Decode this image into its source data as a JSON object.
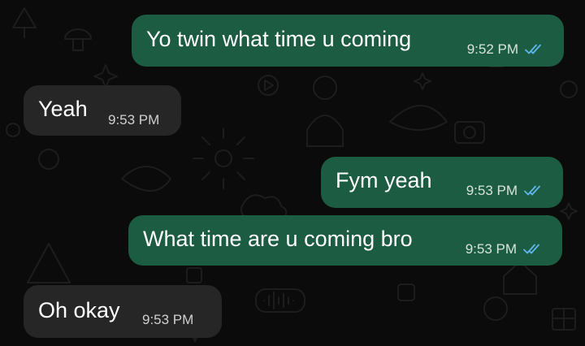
{
  "conversation": {
    "messages": [
      {
        "direction": "outgoing",
        "text": "Yo twin what time u coming",
        "time": "9:52 PM",
        "status": "read"
      },
      {
        "direction": "incoming",
        "text": "Yeah",
        "time": "9:53 PM"
      },
      {
        "direction": "outgoing",
        "text": "Fym yeah",
        "time": "9:53 PM",
        "status": "read"
      },
      {
        "direction": "outgoing",
        "text": "What time are u coming bro",
        "time": "9:53 PM",
        "status": "read"
      },
      {
        "direction": "incoming",
        "text": "Oh okay",
        "time": "9:53 PM"
      }
    ]
  },
  "colors": {
    "background": "#0b0b0b",
    "outgoing_bubble": "#1c5c43",
    "incoming_bubble": "#262626",
    "read_ticks": "#5fb6ec",
    "wallpaper_doodle": "#2c2c2c"
  },
  "icons": {
    "read_receipt": "double-check-icon"
  }
}
